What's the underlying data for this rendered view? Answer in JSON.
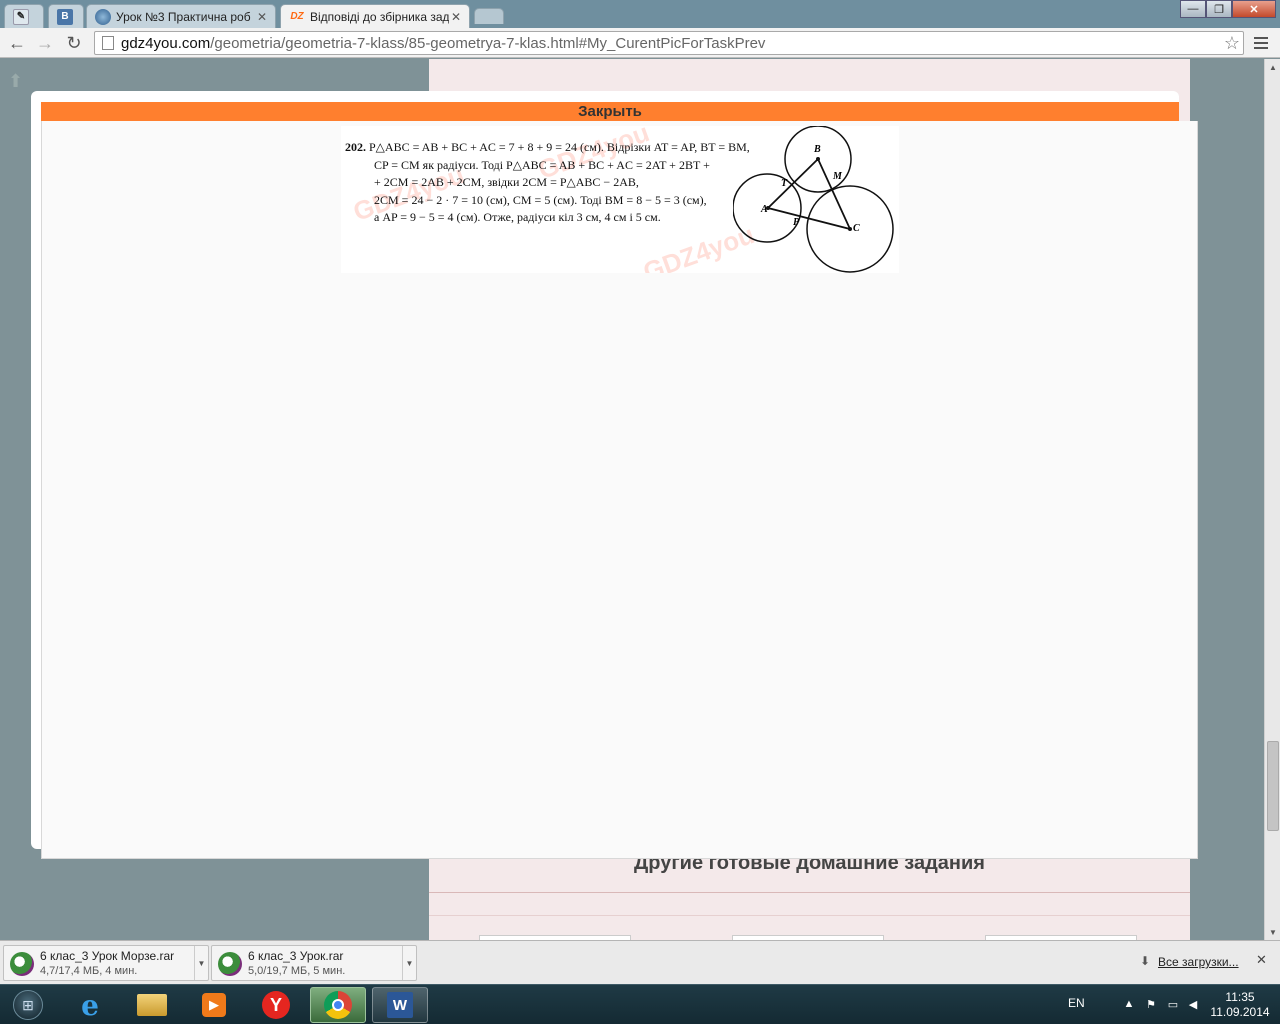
{
  "browser": {
    "tabs": [
      {
        "title": "",
        "icon": "blank-page-icon"
      },
      {
        "title": "",
        "icon": "vk-icon",
        "icon_text": "В"
      },
      {
        "title": "Урок №3 Практична роб",
        "icon": "globe-icon"
      },
      {
        "title": "Відповіді до збірника зад",
        "icon": "gdz-icon",
        "icon_text": "DZ",
        "active": true
      },
      {
        "title": "",
        "icon": "new-tab-icon"
      }
    ],
    "url_host": "gdz4you.com",
    "url_path": "/geometria/geometria-7-klass/85-geometrya-7-klas.html#My_CurentPicForTaskPrev"
  },
  "page": {
    "close_label": "Закрыть",
    "other_heading": "Другие готовые домашние задания",
    "solution": {
      "number": "202.",
      "lines": [
        "P△ABC = AB + BC + AC = 7 + 8 + 9 = 24 (см). Відрізки AT = AP, BT = BM,",
        "CP = CM як радіуси. Тоді P△ABC = AB + BC + AC = 2AT + 2BT +",
        "+ 2CM = 2AB + 2CM, звідки 2CM = P△ABC − 2AB,",
        "2CM = 24 − 2 · 7 = 10 (см), CM = 5 (см). Тоді BM = 8 − 5 = 3 (см),",
        "а AP = 9 − 5 = 4 (см). Отже, радіуси кіл 3 см, 4 см і 5 см."
      ],
      "watermark": "GDZ4you",
      "diagram_labels": {
        "a": "A",
        "b": "B",
        "c": "C",
        "t": "T",
        "m": "M",
        "p": "P"
      }
    }
  },
  "downloads": {
    "items": [
      {
        "name": "6 клас_3 Урок Морзе.rar",
        "status": "4,7/17,4 МБ, 4 мин."
      },
      {
        "name": "6 клас_3 Урок.rar",
        "status": "5,0/19,7 МБ, 5 мин."
      }
    ],
    "all_label": "Все загрузки..."
  },
  "taskbar": {
    "lang": "EN",
    "time": "11:35",
    "date": "11.09.2014",
    "apps": [
      "windows-explorer-icon",
      "internet-explorer-icon",
      "file-manager-icon",
      "media-player-icon",
      "yandex-browser-icon",
      "chrome-icon",
      "word-icon"
    ]
  },
  "colors": {
    "close_bar": "#ff7f2e",
    "page_bg": "#7f9297",
    "tabstrip": "#6f8f9f"
  }
}
